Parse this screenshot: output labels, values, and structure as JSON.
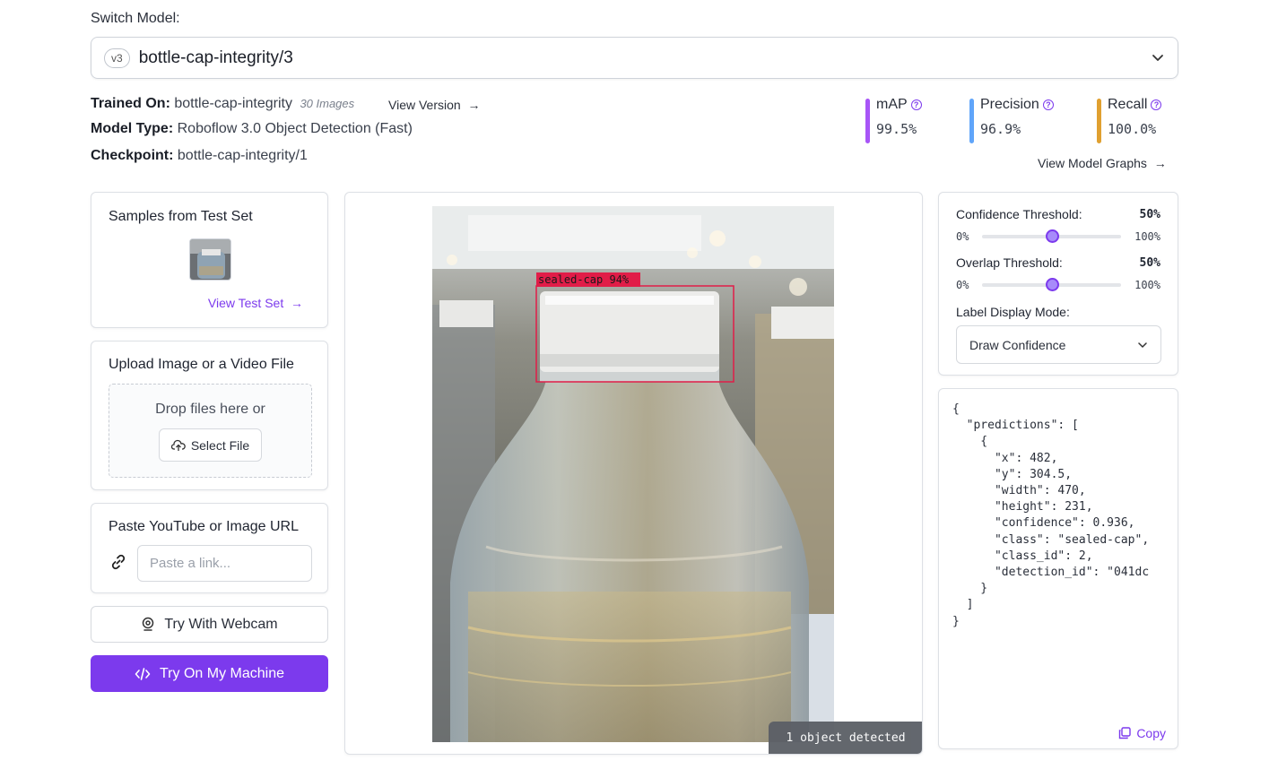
{
  "header": {
    "switch_label": "Switch Model:",
    "version_pill": "v3",
    "model_name": "bottle-cap-integrity/3"
  },
  "model_info": {
    "trained_on_label": "Trained On:",
    "trained_on_value": "bottle-cap-integrity",
    "trained_on_count": "30 Images",
    "view_version": "View Version",
    "type_label": "Model Type:",
    "type_value": "Roboflow 3.0 Object Detection (Fast)",
    "checkpoint_label": "Checkpoint:",
    "checkpoint_value": "bottle-cap-integrity/1"
  },
  "metrics": [
    {
      "name": "mAP",
      "value": "99.5%",
      "color": "#a855f7"
    },
    {
      "name": "Precision",
      "value": "96.9%",
      "color": "#60a5fa"
    },
    {
      "name": "Recall",
      "value": "100.0%",
      "color": "#e0a030"
    }
  ],
  "view_graphs": "View Model Graphs",
  "samples": {
    "title": "Samples from Test Set",
    "view_test_set": "View Test Set"
  },
  "upload": {
    "title": "Upload Image or a Video File",
    "drop_text": "Drop files here or",
    "select_file": "Select File"
  },
  "url": {
    "title": "Paste YouTube or Image URL",
    "placeholder": "Paste a link..."
  },
  "webcam_button": "Try With Webcam",
  "machine_button": "Try On My Machine",
  "detection": {
    "label": "sealed-cap 94%",
    "badge": "1 object detected",
    "box_color": "#e11d48"
  },
  "settings": {
    "confidence_label": "Confidence Threshold:",
    "confidence_value": "50%",
    "confidence_fraction": 0.5,
    "overlap_label": "Overlap Threshold:",
    "overlap_value": "50%",
    "overlap_fraction": 0.5,
    "range_min": "0%",
    "range_max": "100%",
    "label_mode_label": "Label Display Mode:",
    "label_mode_value": "Draw Confidence"
  },
  "json_output": "{\n  \"predictions\": [\n    {\n      \"x\": 482,\n      \"y\": 304.5,\n      \"width\": 470,\n      \"height\": 231,\n      \"confidence\": 0.936,\n      \"class\": \"sealed-cap\",\n      \"class_id\": 2,\n      \"detection_id\": \"041dc\n    }\n  ]\n}",
  "copy_label": "Copy",
  "accent_color": "#7c3aed"
}
